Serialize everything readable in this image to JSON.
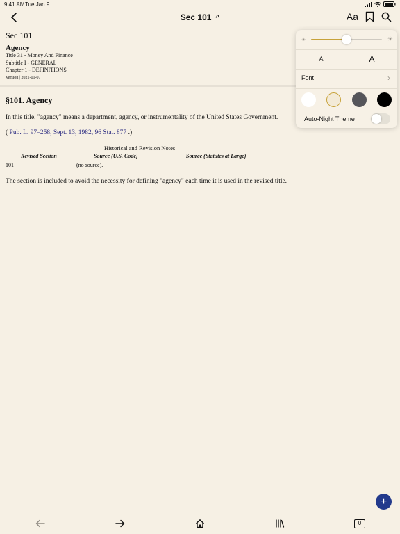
{
  "status_bar": {
    "time": "9:41 AM",
    "date": "Tue Jan 9",
    "icons": [
      "cellular-icon",
      "wifi-icon",
      "battery-icon"
    ]
  },
  "nav": {
    "title": "Sec 101",
    "back_icon": "chevron-left-icon",
    "title_caret": "^",
    "text_settings_label": "Aa",
    "right_icons": [
      "bookmark-icon",
      "search-icon"
    ]
  },
  "document": {
    "section_label": "Sec 101",
    "heading": "Agency",
    "breadcrumbs": [
      "Title 31 - Money And Finance",
      "Subtitle I - GENERAL",
      "Chapter 1 - DEFINITIONS"
    ],
    "version": "Version | 2021-01-07",
    "section_title": "§101. Agency",
    "body": "In this title, \"agency\" means a department, agency, or instrumentality of the United States Government.",
    "citation_open": "( ",
    "citation_link": "Pub. L. 97–258, Sept. 13, 1982, 96 Stat. 877",
    "citation_close": " .)",
    "notes": {
      "title": "Historical and Revision Notes",
      "headers": [
        "Revised Section",
        "Source (U.S. Code)",
        "Source (Statutes at Large)"
      ],
      "rows": [
        [
          "101",
          "(no source).",
          ""
        ]
      ]
    },
    "closing_paragraph": "The section is included to avoid the necessity for defining \"agency\" each time it is used in the revised title."
  },
  "settings_popover": {
    "brightness": 0.5,
    "brightness_icons": [
      "sun-small-icon",
      "sun-large-icon"
    ],
    "font_size_small_label": "A",
    "font_size_large_label": "A",
    "font_label": "Font",
    "themes": [
      {
        "name": "white",
        "color": "#ffffff",
        "selected": false
      },
      {
        "name": "sepia",
        "color": "#f3ead7",
        "selected": true
      },
      {
        "name": "gray",
        "color": "#55555a",
        "selected": false
      },
      {
        "name": "black",
        "color": "#000000",
        "selected": false
      }
    ],
    "auto_night_label": "Auto-Night Theme",
    "auto_night_on": false
  },
  "fab": {
    "label": "+",
    "icon": "plus-icon"
  },
  "toolbar": {
    "items": [
      "back-arrow-icon",
      "forward-arrow-icon",
      "home-icon",
      "library-icon",
      "tabs-icon"
    ],
    "tabs_count": "0"
  },
  "colors": {
    "background": "#f6f0e4",
    "accent": "#c7a23a",
    "fab": "#233a8c",
    "link": "#2a2a80"
  }
}
